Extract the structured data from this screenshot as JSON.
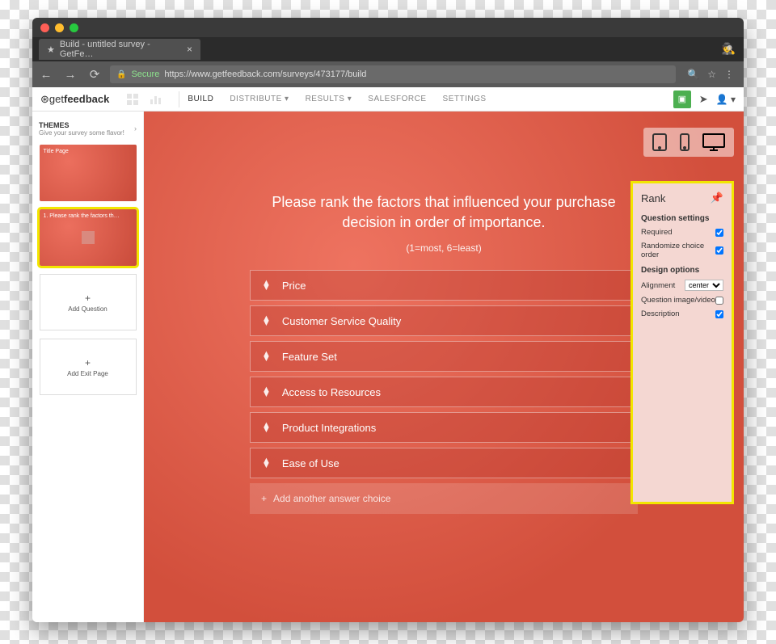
{
  "browser": {
    "tab_title": "Build - untitled survey - GetFe…",
    "secure_label": "Secure",
    "url": "https://www.getfeedback.com/surveys/473177/build"
  },
  "logo": {
    "pre": "get",
    "bold": "feedback"
  },
  "nav": {
    "build": "BUILD",
    "distribute": "DISTRIBUTE",
    "results": "RESULTS",
    "salesforce": "SALESFORCE",
    "settings": "SETTINGS"
  },
  "sidebar": {
    "themes_title": "THEMES",
    "themes_sub": "Give your survey some flavor!",
    "thumb1_label": "Title Page",
    "thumb2_label": "1. Please rank the factors th…",
    "add_question": "Add Question",
    "add_exit": "Add Exit Page"
  },
  "question": {
    "text": "Please rank the factors that influenced your purchase decision in order of importance.",
    "hint": "(1=most, 6=least)"
  },
  "choices": [
    "Price",
    "Customer Service Quality",
    "Feature Set",
    "Access to Resources",
    "Product Integrations",
    "Ease of Use"
  ],
  "add_choice": "Add another answer choice",
  "panel": {
    "title": "Rank",
    "section1": "Question settings",
    "required": "Required",
    "randomize": "Randomize choice order",
    "section2": "Design options",
    "alignment": "Alignment",
    "alignment_value": "center",
    "qimage": "Question image/video",
    "description": "Description"
  }
}
